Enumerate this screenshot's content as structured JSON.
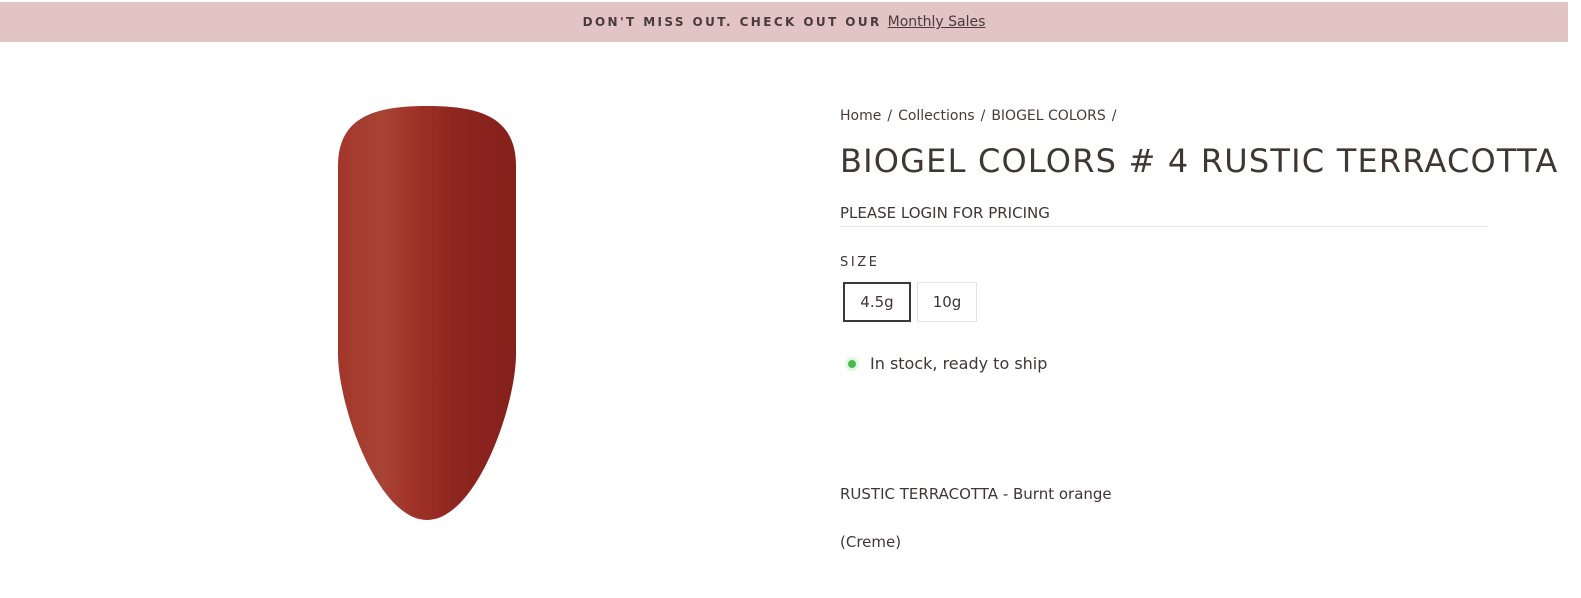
{
  "announcement": {
    "text": "DON'T MISS OUT. CHECK OUT OUR",
    "link": "Monthly Sales",
    "background": "#e3c4c4"
  },
  "breadcrumb": {
    "items": [
      "Home",
      "Collections",
      "BIOGEL COLORS"
    ],
    "separator": "/"
  },
  "product": {
    "title": "BIOGEL COLORS # 4 RUSTIC TERRACOTTA",
    "pricing": "PLEASE LOGIN FOR PRICING",
    "size_label": "SIZE",
    "sizes": [
      "4.5g",
      "10g"
    ],
    "selected_size": "4.5g",
    "stock": "In stock, ready to ship",
    "stock_color": "#4cbb4c",
    "description": "RUSTIC TERRACOTTA - Burnt orange",
    "finish": "(Creme)",
    "swatch_color": "#a3362b"
  }
}
